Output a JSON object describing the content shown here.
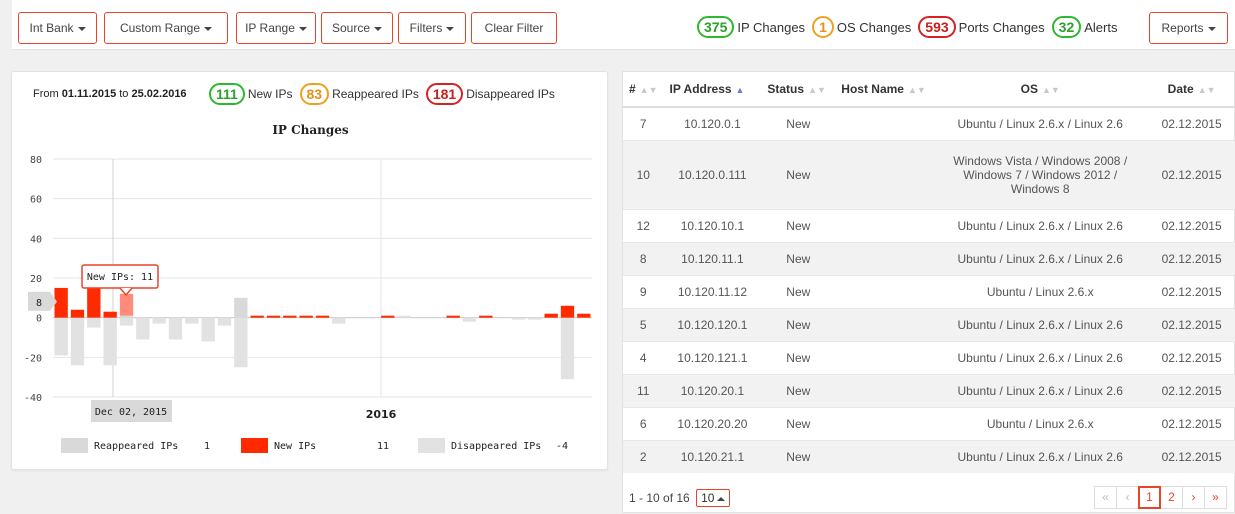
{
  "toolbar": {
    "buttons": [
      {
        "label": "Int Bank",
        "caret": true
      },
      {
        "label": "Custom Range",
        "caret": true
      },
      {
        "label": "IP Range",
        "caret": true
      },
      {
        "label": "Source",
        "caret": true
      },
      {
        "label": "Filters",
        "caret": true
      },
      {
        "label": "Clear Filter",
        "caret": false
      }
    ],
    "stats": [
      {
        "value": "375",
        "label": "IP Changes",
        "color": "green"
      },
      {
        "value": "1",
        "label": "OS Changes",
        "color": "orange"
      },
      {
        "value": "593",
        "label": "Ports Changes",
        "color": "red"
      },
      {
        "value": "32",
        "label": "Alerts",
        "color": "green"
      }
    ],
    "reports_label": "Reports"
  },
  "chart_panel": {
    "period_prefix": "From",
    "period_from": "01.11.2015",
    "period_mid": "to",
    "period_to": "25.02.2016",
    "stats": [
      {
        "value": "111",
        "label": "New IPs",
        "color": "green"
      },
      {
        "value": "83",
        "label": "Reappeared IPs",
        "color": "orange"
      },
      {
        "value": "181",
        "label": "Disappeared IPs",
        "color": "red"
      }
    ]
  },
  "chart_data": {
    "type": "bar",
    "title": "IP Changes",
    "xlabel": "",
    "ylabel": "",
    "ylim": [
      -40,
      80
    ],
    "yticks": [
      -40,
      -20,
      0,
      20,
      40,
      60,
      80
    ],
    "x_tick_label": "2016",
    "colors": {
      "new": "#ff2a00",
      "reappeared": "#d9d9d9",
      "disappeared": "#e2e2e2"
    },
    "series": [
      {
        "name": "New IPs",
        "values": [
          15,
          4,
          20,
          3,
          11,
          0,
          0,
          0,
          0,
          0,
          0,
          0,
          1,
          1,
          1,
          1,
          1,
          0,
          0,
          0,
          1,
          0,
          0,
          0,
          1,
          0,
          1,
          0,
          0,
          0,
          2,
          6,
          2
        ]
      },
      {
        "name": "Reappeared IPs",
        "values": [
          0,
          0,
          0,
          0,
          1,
          0,
          0,
          0,
          0,
          0,
          0,
          10,
          0,
          0,
          0,
          0,
          0,
          0,
          0,
          0,
          0,
          0,
          0,
          0,
          0,
          0,
          0,
          0,
          0,
          0,
          0,
          0,
          0
        ]
      },
      {
        "name": "Disappeared IPs",
        "values": [
          -19,
          -24,
          -5,
          -24,
          -4,
          -11,
          -3,
          -11,
          -3,
          -12,
          -4,
          -25,
          0,
          0,
          0,
          0,
          0,
          -3,
          0,
          0,
          0,
          1,
          0,
          0,
          0,
          -2,
          0,
          0,
          -1,
          -1,
          0,
          -31,
          0
        ]
      }
    ],
    "highlight_index": 4,
    "tooltip": "New IPs: 11",
    "crosshair_label": "Dec 02, 2015",
    "y_flag": "8",
    "legend": [
      {
        "name": "Reappeared IPs",
        "value": "1"
      },
      {
        "name": "New IPs",
        "value": "11"
      },
      {
        "name": "Disappeared IPs",
        "value": "-4"
      }
    ]
  },
  "table": {
    "columns": [
      "#",
      "IP Address",
      "Status",
      "Host Name",
      "OS",
      "Date"
    ],
    "rows": [
      {
        "n": "7",
        "ip": "10.120.0.1",
        "status": "New",
        "host": "",
        "os": "Ubuntu / Linux 2.6.x / Linux 2.6",
        "date": "02.12.2015"
      },
      {
        "n": "10",
        "ip": "10.120.0.111",
        "status": "New",
        "host": "",
        "os": "Windows Vista / Windows 2008 / Windows 7 / Windows 2012 / Windows 8",
        "date": "02.12.2015"
      },
      {
        "n": "12",
        "ip": "10.120.10.1",
        "status": "New",
        "host": "",
        "os": "Ubuntu / Linux 2.6.x / Linux 2.6",
        "date": "02.12.2015"
      },
      {
        "n": "8",
        "ip": "10.120.11.1",
        "status": "New",
        "host": "",
        "os": "Ubuntu / Linux 2.6.x / Linux 2.6",
        "date": "02.12.2015"
      },
      {
        "n": "9",
        "ip": "10.120.11.12",
        "status": "New",
        "host": "",
        "os": "Ubuntu / Linux 2.6.x",
        "date": "02.12.2015"
      },
      {
        "n": "5",
        "ip": "10.120.120.1",
        "status": "New",
        "host": "",
        "os": "Ubuntu / Linux 2.6.x / Linux 2.6",
        "date": "02.12.2015"
      },
      {
        "n": "4",
        "ip": "10.120.121.1",
        "status": "New",
        "host": "",
        "os": "Ubuntu / Linux 2.6.x / Linux 2.6",
        "date": "02.12.2015"
      },
      {
        "n": "11",
        "ip": "10.120.20.1",
        "status": "New",
        "host": "",
        "os": "Ubuntu / Linux 2.6.x / Linux 2.6",
        "date": "02.12.2015"
      },
      {
        "n": "6",
        "ip": "10.120.20.20",
        "status": "New",
        "host": "",
        "os": "Ubuntu / Linux 2.6.x",
        "date": "02.12.2015"
      },
      {
        "n": "2",
        "ip": "10.120.21.1",
        "status": "New",
        "host": "",
        "os": "Ubuntu / Linux 2.6.x / Linux 2.6",
        "date": "02.12.2015"
      }
    ],
    "footer": {
      "info": "1 - 10 of 16",
      "page_size": "10",
      "pages": [
        "«",
        "‹",
        "1",
        "2",
        "›",
        "»"
      ],
      "current_page": "1"
    }
  }
}
